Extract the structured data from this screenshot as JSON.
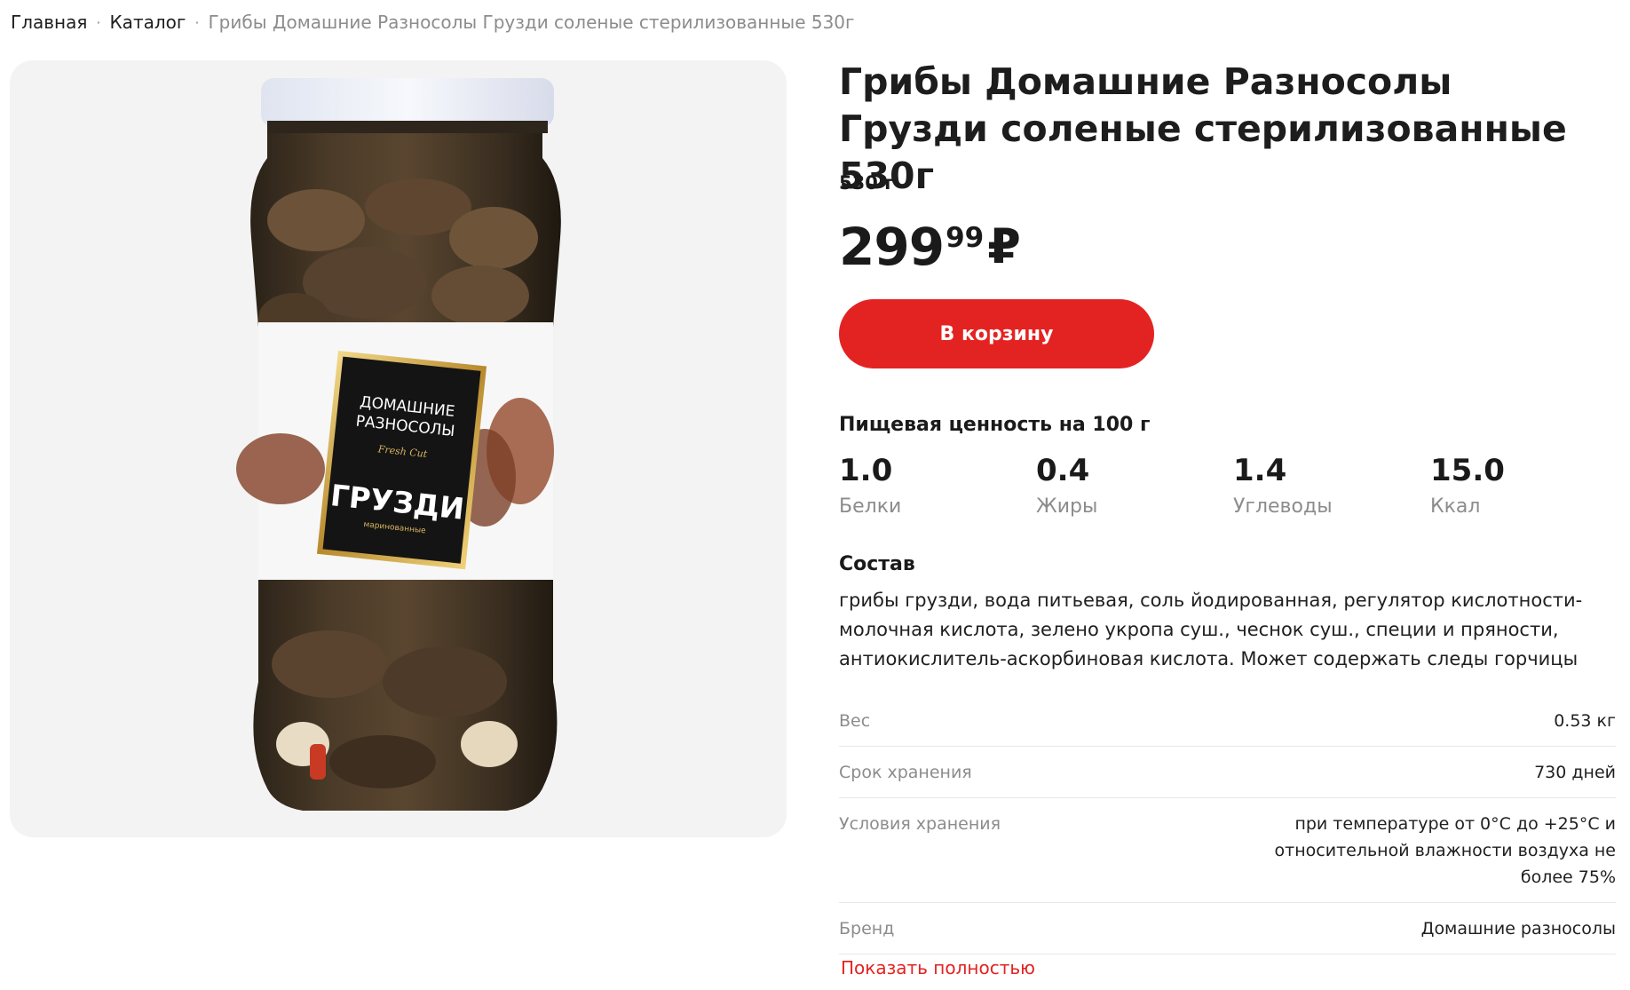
{
  "breadcrumb": {
    "home": "Главная",
    "catalog": "Каталог",
    "current": "Грибы Домашние Разносолы Грузди соленые стерилизованные 530г",
    "separator": "·"
  },
  "product": {
    "title": "Грибы Домашние Разносолы Грузди соленые стерилизованные 530г",
    "weight": "530 г",
    "price_rub": "299",
    "price_kop": "99",
    "currency": "₽",
    "cart_button": "В корзину",
    "image_label": {
      "brand_line1": "ДОМАШНИЕ",
      "brand_line2": "РАЗНОСОЛЫ",
      "fresh_cut": "Fresh Cut",
      "name": "ГРУЗДИ",
      "subname": "маринованные"
    }
  },
  "nutrition": {
    "title": "Пищевая ценность на 100 г",
    "items": [
      {
        "value": "1.0",
        "label": "Белки"
      },
      {
        "value": "0.4",
        "label": "Жиры"
      },
      {
        "value": "1.4",
        "label": "Углеводы"
      },
      {
        "value": "15.0",
        "label": "Ккал"
      }
    ]
  },
  "composition": {
    "title": "Состав",
    "text": "грибы грузди, вода питьевая, соль йодированная, регулятор кислотности-молочная кислота, зелено укропа суш., чеснок суш., специи и пряности, антиокислитель-аскорбиновая кислота. Может содержать следы горчицы"
  },
  "specs": [
    {
      "label": "Вес",
      "value": "0.53 кг"
    },
    {
      "label": "Срок хранения",
      "value": "730 дней"
    },
    {
      "label": "Условия хранения",
      "value": "при температуре от 0°С до +25°С и относительной влажности воздуха не более 75%"
    },
    {
      "label": "Бренд",
      "value": "Домашние разносолы"
    }
  ],
  "show_more": "Показать полностью",
  "colors": {
    "accent": "#e32322",
    "muted": "#8c8c8c",
    "panel": "#f3f3f3"
  }
}
